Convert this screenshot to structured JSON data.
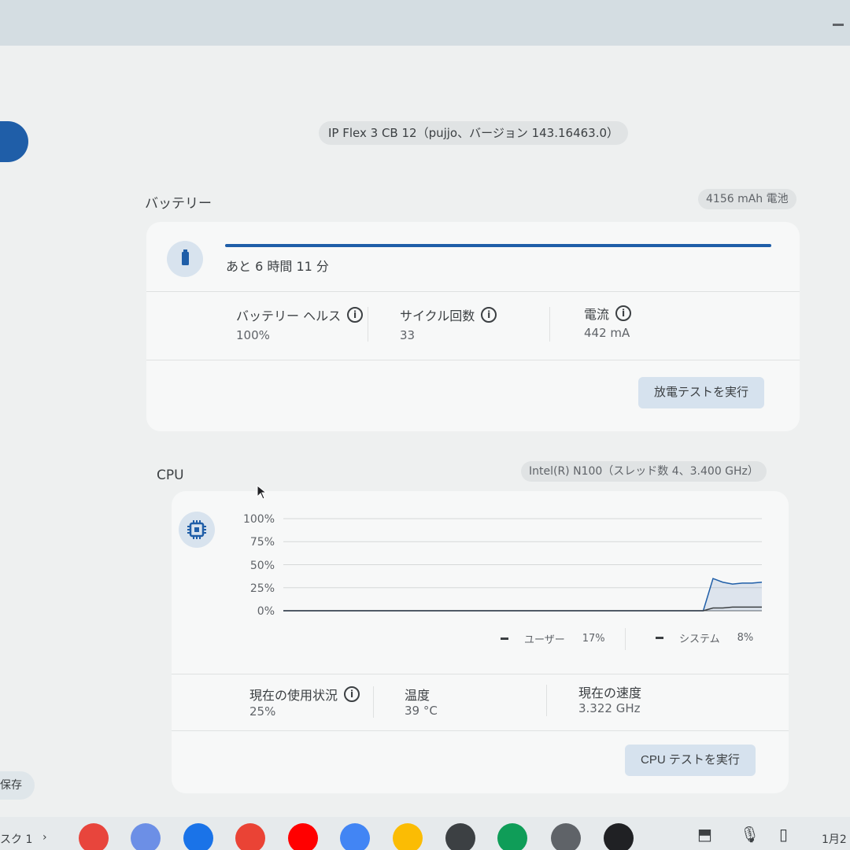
{
  "header": {
    "model": "IP Flex 3 CB 12（pujjo、バージョン 143.16463.0）"
  },
  "sidebar": {
    "save_label": "保存"
  },
  "battery": {
    "title": "バッテリー",
    "capacity": "4156 mAh 電池",
    "remaining": "あと 6 時間 11 分",
    "charge_level": 1.0,
    "stats": [
      {
        "label": "バッテリー ヘルス",
        "value": "100%"
      },
      {
        "label": "サイクル回数",
        "value": "33"
      },
      {
        "label": "電流",
        "value": "442 mA"
      }
    ],
    "test_button": "放電テストを実行"
  },
  "cpu": {
    "title": "CPU",
    "model": "Intel(R) N100（スレッド数 4、3.400 GHz）",
    "legend": [
      {
        "name": "ユーザー",
        "value": "17%"
      },
      {
        "name": "システム",
        "value": "8%"
      }
    ],
    "stats": [
      {
        "label": "現在の使用状況",
        "value": "25%"
      },
      {
        "label": "温度",
        "value": "39 °C"
      },
      {
        "label": "現在の速度",
        "value": "3.322 GHz"
      }
    ],
    "test_button": "CPU テストを実行"
  },
  "chart_data": {
    "type": "area",
    "y_ticks": [
      "100%",
      "75%",
      "50%",
      "25%",
      "0%"
    ],
    "ylim": [
      0,
      100
    ],
    "grid": true,
    "legend_position": "bottom-right",
    "colors": {
      "user": "#1f5ea8",
      "system": "#3c4043"
    },
    "x": [
      0,
      1,
      2,
      3,
      4,
      5,
      6,
      7,
      8,
      9,
      10,
      11,
      12,
      13,
      14,
      15,
      16,
      17,
      18,
      19,
      20,
      21,
      22,
      23,
      24,
      25,
      26,
      27,
      28,
      29,
      30,
      31,
      32,
      33,
      34,
      35,
      36,
      37,
      38,
      39,
      40,
      41,
      42,
      43,
      44,
      45,
      46,
      47,
      48,
      49
    ],
    "series": [
      {
        "name": "ユーザー",
        "values": [
          0,
          0,
          0,
          0,
          0,
          0,
          0,
          0,
          0,
          0,
          0,
          0,
          0,
          0,
          0,
          0,
          0,
          0,
          0,
          0,
          0,
          0,
          0,
          0,
          0,
          0,
          0,
          0,
          0,
          0,
          0,
          0,
          0,
          0,
          0,
          0,
          0,
          0,
          0,
          0,
          0,
          0,
          0,
          0,
          35,
          31,
          29,
          30,
          30,
          31
        ]
      },
      {
        "name": "システム",
        "values": [
          0,
          0,
          0,
          0,
          0,
          0,
          0,
          0,
          0,
          0,
          0,
          0,
          0,
          0,
          0,
          0,
          0,
          0,
          0,
          0,
          0,
          0,
          0,
          0,
          0,
          0,
          0,
          0,
          0,
          0,
          0,
          0,
          0,
          0,
          0,
          0,
          0,
          0,
          0,
          0,
          0,
          0,
          0,
          0,
          3,
          3,
          4,
          4,
          4,
          4
        ]
      }
    ]
  },
  "shelf": {
    "desk_label": "スク 1",
    "chevron": "›",
    "date": "1月2",
    "apps": [
      {
        "name": "chrome-icon",
        "color": "#e8453c"
      },
      {
        "name": "gemini-icon",
        "color": "#6c8fe6"
      },
      {
        "name": "files-icon",
        "color": "#1a73e8"
      },
      {
        "name": "gmail-icon",
        "color": "#ea4335"
      },
      {
        "name": "youtube-icon",
        "color": "#ff0000"
      },
      {
        "name": "calendar-icon",
        "color": "#4285f4"
      },
      {
        "name": "keep-icon",
        "color": "#fbbc04"
      },
      {
        "name": "terminal-icon",
        "color": "#3c4043"
      },
      {
        "name": "sheets-icon",
        "color": "#0f9d58"
      },
      {
        "name": "settings-icon",
        "color": "#5f6368"
      },
      {
        "name": "diagnostics-icon",
        "color": "#202124"
      }
    ]
  }
}
